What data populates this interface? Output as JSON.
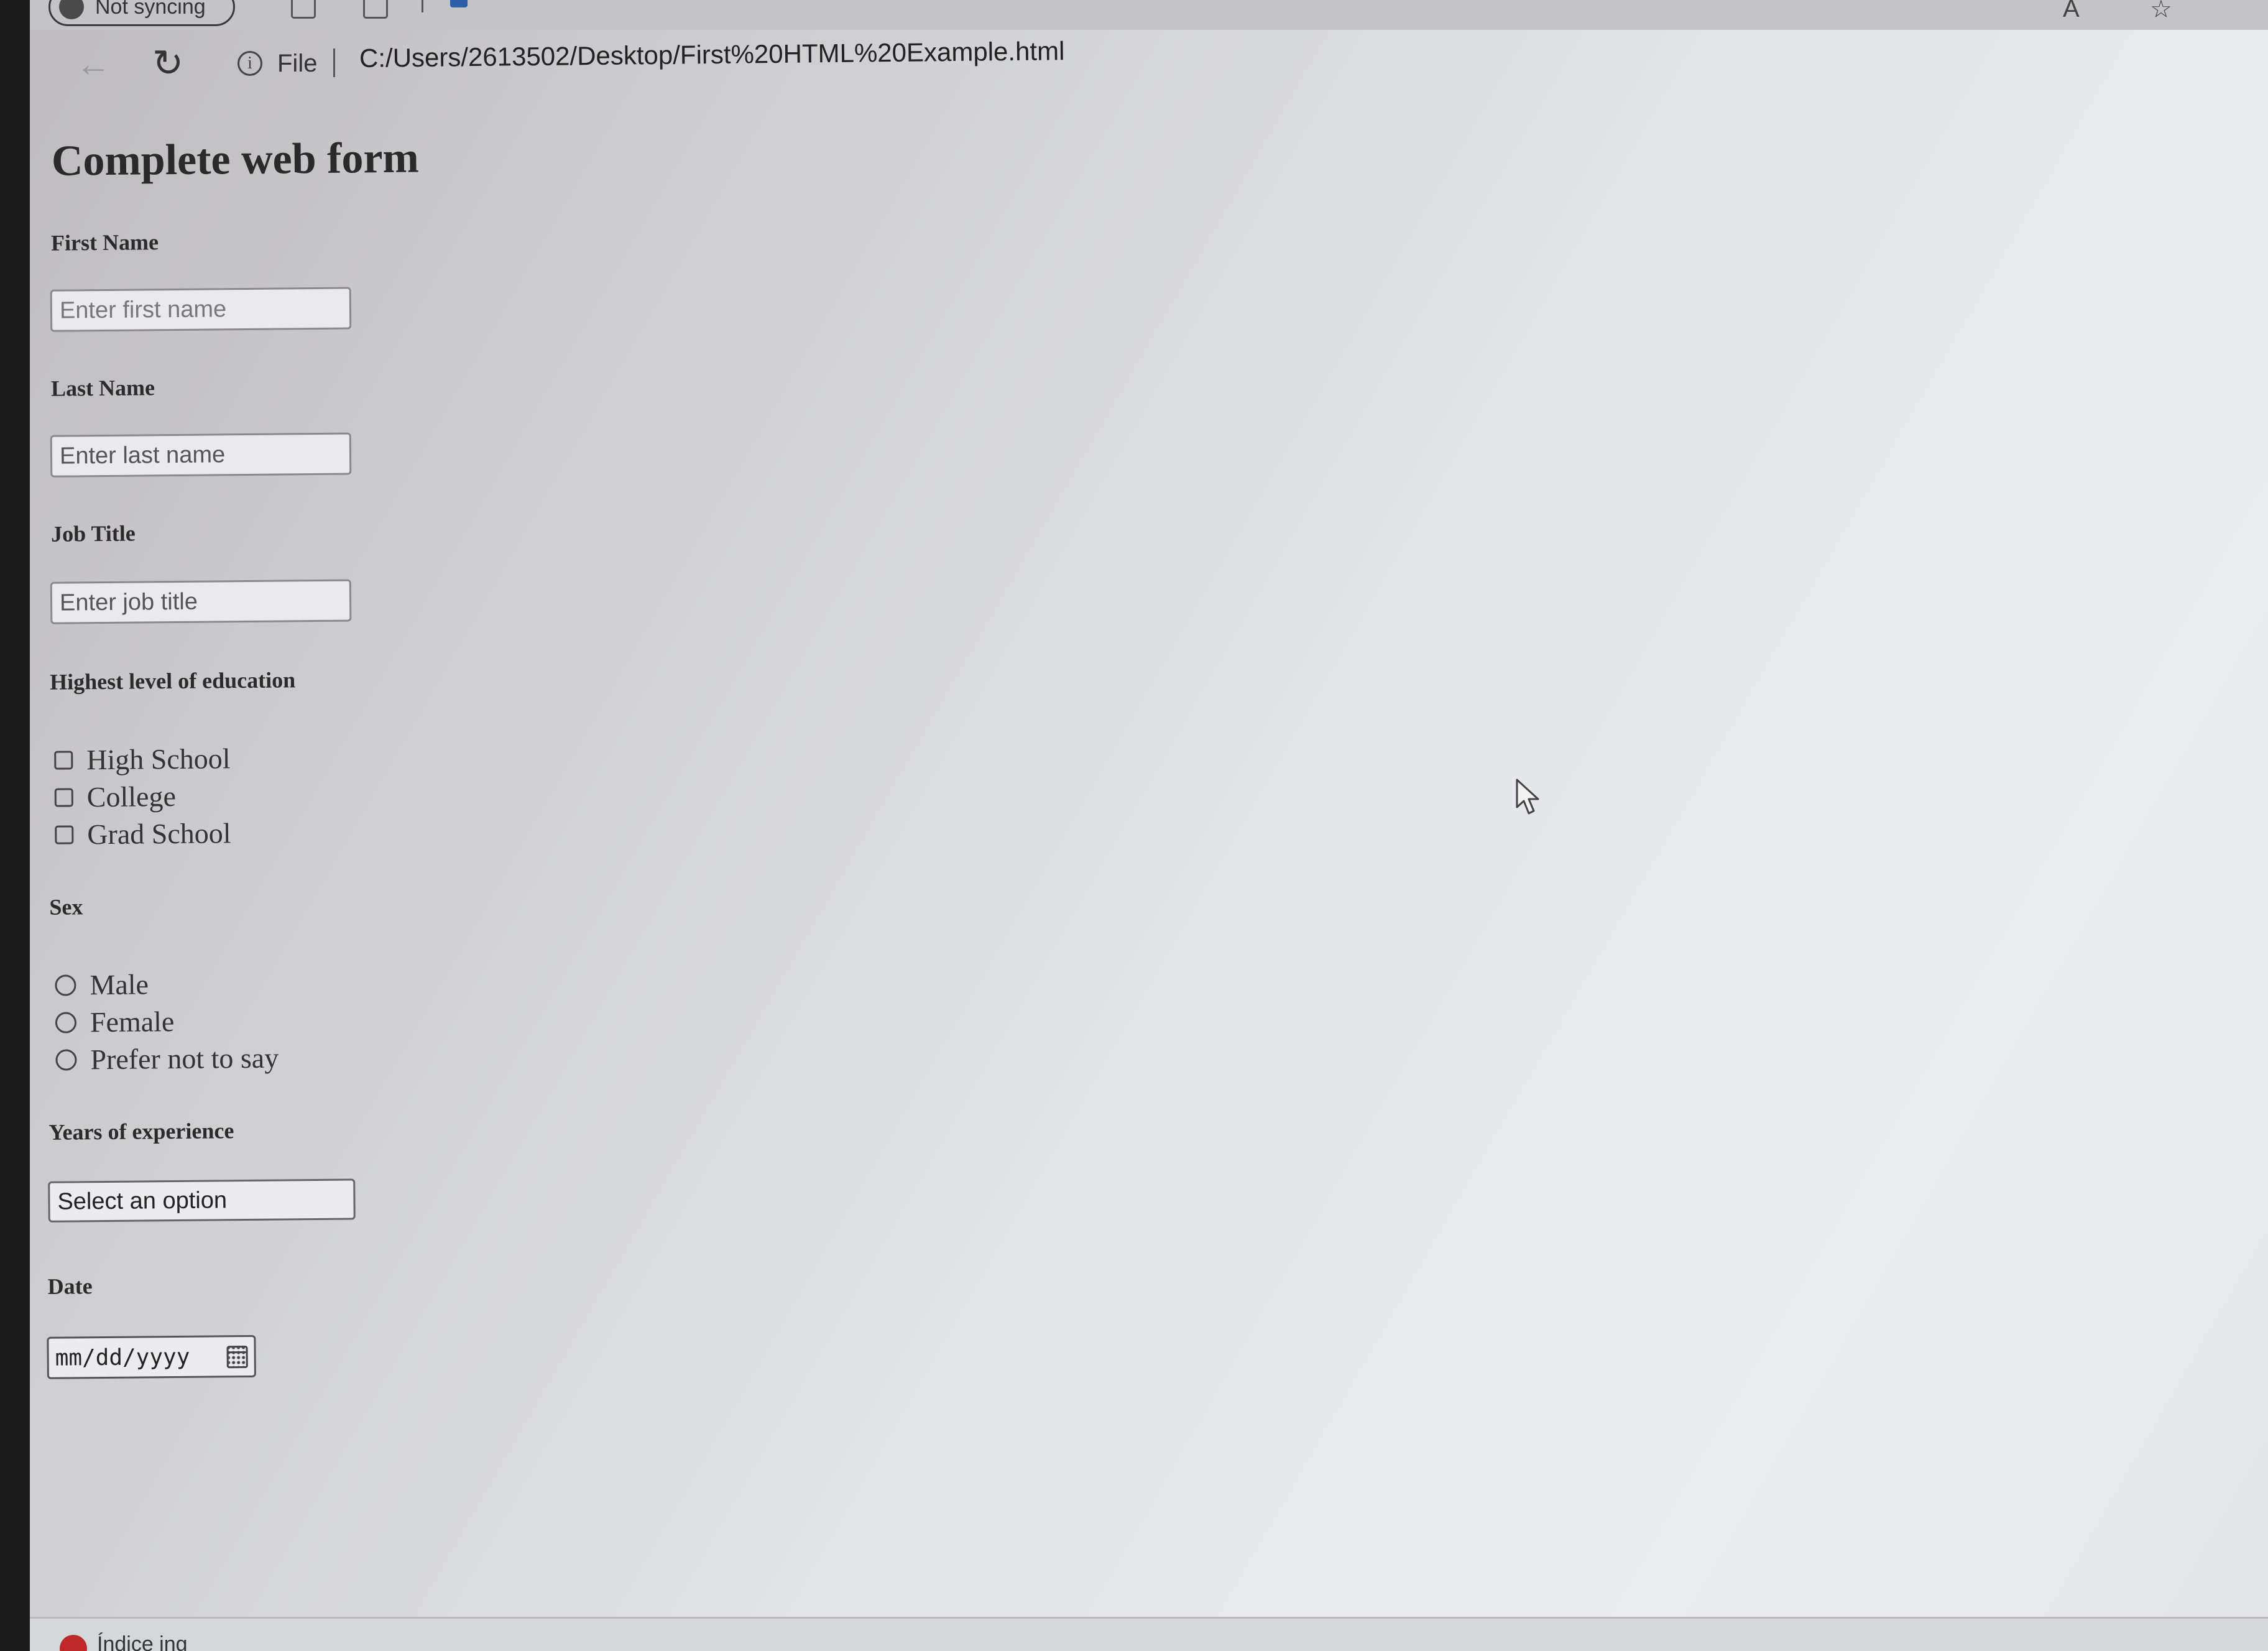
{
  "browser": {
    "profile_status": "Not syncing",
    "info_label": "i",
    "file_label": "File",
    "url": "C:/Users/2613502/Desktop/First%20HTML%20Example.html"
  },
  "form": {
    "title": "Complete web form",
    "first_name": {
      "label": "First Name",
      "placeholder": "Enter first name"
    },
    "last_name": {
      "label": "Last Name",
      "placeholder": "Enter last name"
    },
    "job_title": {
      "label": "Job Title",
      "placeholder": "Enter job title"
    },
    "education": {
      "label": "Highest level of education",
      "options": [
        "High School",
        "College",
        "Grad School"
      ]
    },
    "sex": {
      "label": "Sex",
      "options": [
        "Male",
        "Female",
        "Prefer not to say"
      ]
    },
    "experience": {
      "label": "Years of experience",
      "selected": "Select an option"
    },
    "date": {
      "label": "Date",
      "value": "mm/dd/yyyy"
    }
  },
  "taskbar": {
    "item_text": "Índice ing"
  },
  "colors": {
    "notification": "#c0282a"
  }
}
